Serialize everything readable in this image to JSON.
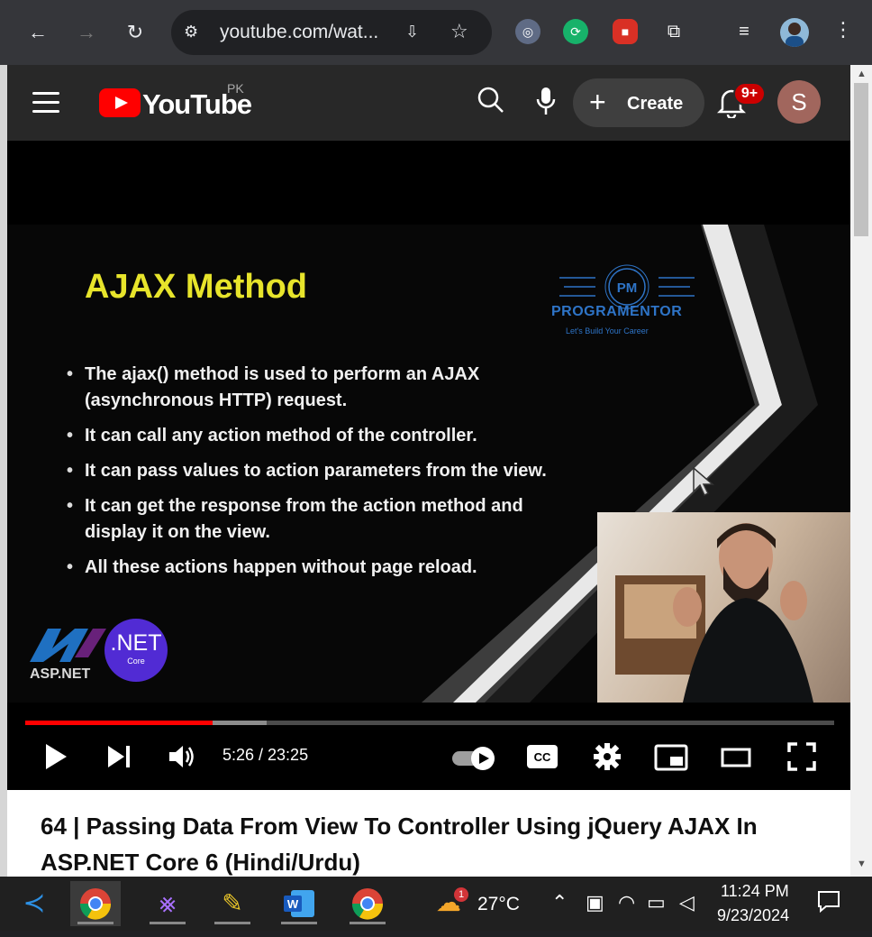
{
  "browser": {
    "url": "youtube.com/wat...",
    "extension_count": 4
  },
  "youtube": {
    "logo_text": "YouTube",
    "country_code": "PK",
    "create_label": "Create",
    "notification_badge": "9+",
    "avatar_initial": "S"
  },
  "slide": {
    "title": "AJAX Method",
    "brand_name": "PROGRAMENTOR",
    "brand_tagline": "Let's Build Your Career",
    "brand_initials": "PM",
    "bullets": [
      "The ajax() method is used to perform an AJAX (asynchronous HTTP) request.",
      "It can call any action method of the controller.",
      "It can pass values to action parameters from the view.",
      "It can get the response from the action method and display it on the view.",
      "All these actions happen without page reload."
    ],
    "asp_label": "ASP.NET",
    "net_label": ".NET",
    "net_sub": "Core"
  },
  "player": {
    "current_time": "5:26",
    "duration": "23:25",
    "time_display": "5:26 / 23:25",
    "progress_fraction": 0.232,
    "buffer_fraction": 0.298
  },
  "video": {
    "title": "64 | Passing Data From View To Controller Using jQuery AJAX In ASP.NET Core 6 (Hindi/Urdu)"
  },
  "taskbar": {
    "weather_temp": "27°C",
    "weather_badge": "1",
    "time": "11:24 PM",
    "date": "9/23/2024"
  },
  "colors": {
    "youtube_red": "#ff0000",
    "slide_title": "#e7e42b",
    "brand_blue": "#2e74c7"
  }
}
